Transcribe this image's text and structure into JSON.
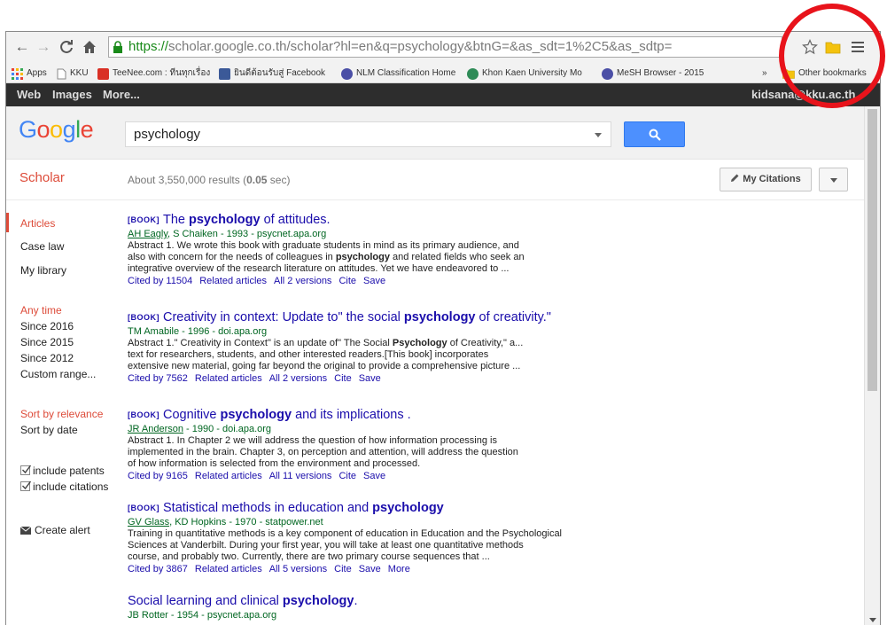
{
  "browser": {
    "url_https": "https://",
    "url_rest": "scholar.google.co.th/scholar?hl=en&q=psychology&btnG=&as_sdt=1%2C5&as_sdtp="
  },
  "bookmarks": [
    {
      "label": "Apps",
      "color": "#e94235"
    },
    {
      "label": "KKU",
      "color": "#9e9e9e"
    },
    {
      "label": "TeeNee.com : ทีนทุกเรื่อง",
      "color": "#d93025"
    },
    {
      "label": "ยินดีต้อนรับสู่ Facebook",
      "color": "#3b5998"
    },
    {
      "label": "NLM Classification Home",
      "color": "#4b4fa6"
    },
    {
      "label": "Khon Kaen University Mo",
      "color": "#2e8b57"
    },
    {
      "label": "MeSH Browser - 2015",
      "color": "#4b4fa6"
    },
    {
      "label": "»",
      "color": ""
    },
    {
      "label": "Other bookmarks",
      "color": "#f4c20d"
    }
  ],
  "gbar": {
    "web": "Web",
    "images": "Images",
    "more": "More...",
    "account": "kidsana@kku.ac.th"
  },
  "search": {
    "logo": "Google",
    "query": "psychology"
  },
  "results_bar": {
    "scholar_label": "Scholar",
    "count_prefix": "About 3,550,000 results (",
    "count_time": "0.05",
    "count_suffix": " sec)",
    "my_citations": "My Citations"
  },
  "sidebar": {
    "articles": "Articles",
    "case_law": "Case law",
    "my_library": "My library",
    "any_time": "Any time",
    "since_2016": "Since 2016",
    "since_2015": "Since 2015",
    "since_2012": "Since 2012",
    "custom_range": "Custom range...",
    "sort_relevance": "Sort by relevance",
    "sort_date": "Sort by date",
    "include_patents": "include patents",
    "include_citations": "include citations",
    "create_alert": "Create alert"
  },
  "results": [
    {
      "tag": "[BOOK]",
      "title_pre": "The ",
      "title_bold": "psychology",
      "title_post": " of attitudes.",
      "author_link": "AH Eagly",
      "author_rest": ", S Chaiken - 1993 - psycnet.apa.org",
      "snippet1": "Abstract 1. We wrote this book with graduate students in mind as its primary audience, and",
      "snippet2_pre": "also with concern for the needs of colleagues in ",
      "snippet2_bold": "psychology",
      "snippet2_post": " and related fields who seek an",
      "snippet3": "integrative overview of the research literature on attitudes. Yet we have endeavored to ...",
      "links": [
        "Cited by 11504",
        "Related articles",
        "All 2 versions",
        "Cite",
        "Save"
      ]
    },
    {
      "tag": "[BOOK]",
      "title_pre": "Creativity in context: Update to\" the social ",
      "title_bold": "psychology",
      "title_post": " of creativity.\"",
      "author_link": "",
      "author_rest": "TM Amabile - 1996 - doi.apa.org",
      "snippet1_pre": "Abstract 1.\" Creativity in Context\" is an update of\" The Social ",
      "snippet1_bold": "Psychology",
      "snippet1_post": " of Creativity,\" a...",
      "snippet2": "text for researchers, students, and other interested readers.[This book] incorporates",
      "snippet3": "extensive new material, going far beyond the original to provide a comprehensive picture ...",
      "links": [
        "Cited by 7562",
        "Related articles",
        "All 2 versions",
        "Cite",
        "Save"
      ]
    },
    {
      "tag": "[BOOK]",
      "title_pre": "Cognitive ",
      "title_bold": "psychology",
      "title_post": " and its implications .",
      "author_link": "JR Anderson",
      "author_rest": " - 1990 - doi.apa.org",
      "snippet1": "Abstract 1. In Chapter 2 we will address the question of how information processing is",
      "snippet2": "implemented in the brain. Chapter 3, on perception and attention, will address the question",
      "snippet3": "of how information is selected from the environment and processed.",
      "links": [
        "Cited by 9165",
        "Related articles",
        "All 11 versions",
        "Cite",
        "Save"
      ]
    },
    {
      "tag": "[BOOK]",
      "title_pre": "Statistical methods in education and ",
      "title_bold": "psychology",
      "title_post": "",
      "author_link": "GV Glass",
      "author_rest": ", KD Hopkins - 1970 - statpower.net",
      "snippet1": "Training in quantitative methods is a key component of education in Education and the Psychological",
      "snippet2": "Sciences at Vanderbilt. During your first year, you will take at least one quantitative methods",
      "snippet3": "course, and probably two. Currently, there are two primary course sequences that ...",
      "links": [
        "Cited by 3867",
        "Related articles",
        "All 5 versions",
        "Cite",
        "Save",
        "More"
      ]
    },
    {
      "tag": "",
      "title_pre": "Social learning and clinical ",
      "title_bold": "psychology",
      "title_post": ".",
      "author_link": "",
      "author_rest": "JB Rotter - 1954 - psycnet.apa.org"
    }
  ],
  "colors": {
    "link_blue": "#1a0dab",
    "author_green": "#006621",
    "scholar_red": "#dd4b39",
    "search_blue": "#4d90fe",
    "annotation_red": "#e8131b"
  }
}
